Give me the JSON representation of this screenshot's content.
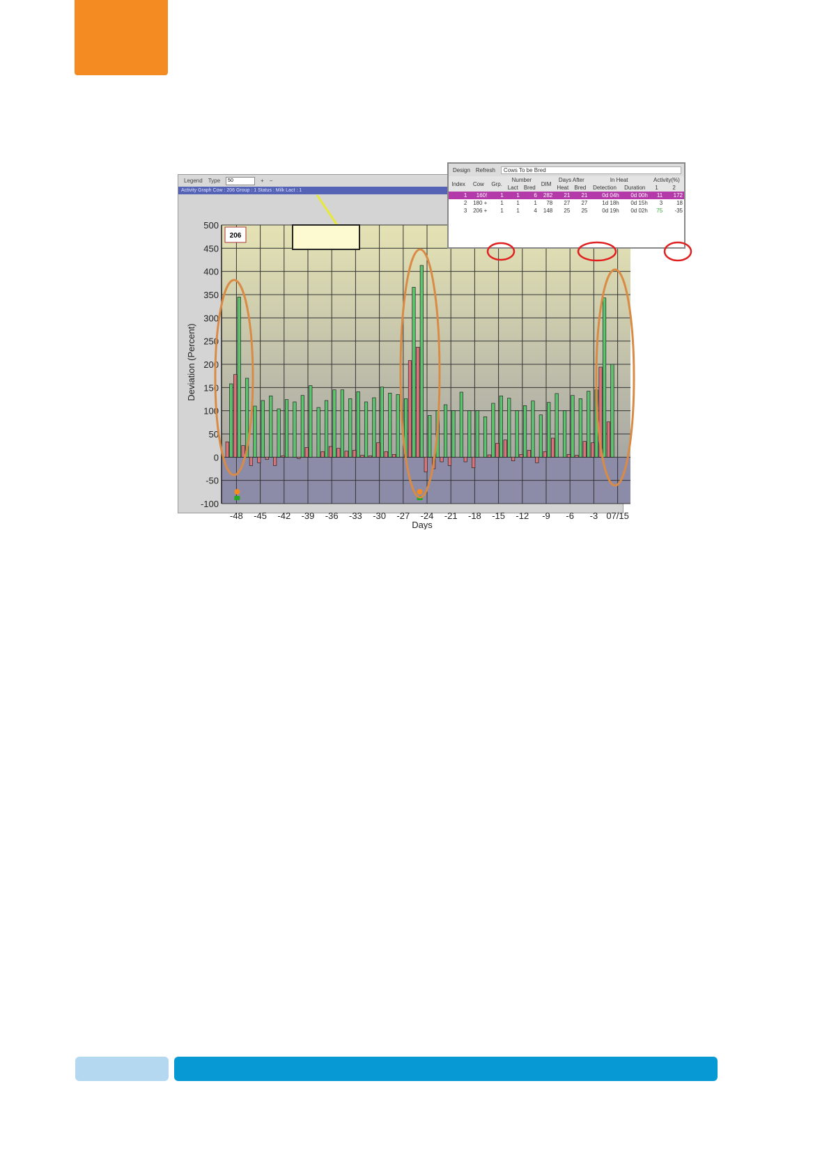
{
  "toolbar": {
    "legend": "Legend",
    "type": "Type",
    "zoom_value": "50"
  },
  "status_bar": "Activity Graph   Cow : 206   Group : 1   Status : Milk   Lact : 1",
  "cow_label": "206",
  "table_panel": {
    "design": "Design",
    "refresh": "Refresh",
    "report": "Cows To be Bred",
    "groups": [
      "Number",
      "Days After",
      "In Heat",
      "Activity(%)"
    ],
    "columns": [
      "Index",
      "Cow",
      "Grp.",
      "Lact",
      "Bred",
      "DIM",
      "Heat",
      "Bred",
      "Detection",
      "Duration",
      "1",
      "2"
    ],
    "rows": [
      [
        "1",
        "160!",
        "1",
        "1",
        "6",
        "282",
        "21",
        "21",
        "0d 04h",
        "0d 00h",
        "11",
        "172"
      ],
      [
        "2",
        "180 +",
        "1",
        "1",
        "1",
        "78",
        "27",
        "27",
        "1d 18h",
        "0d 15h",
        "3",
        "18"
      ],
      [
        "3",
        "206 +",
        "1",
        "1",
        "4",
        "148",
        "25",
        "25",
        "0d 19h",
        "0d 02h",
        "75",
        "-35"
      ]
    ]
  },
  "colors": {
    "green": "#5cc46e",
    "red": "#d9757a",
    "selected_row": "#b33aa8",
    "highlight_oval": "#d98b45",
    "circle": "#e02020",
    "accent_orange": "#f48a22",
    "accent_blue": "#0699d4"
  },
  "chart_data": {
    "type": "bar",
    "xlabel": "Days",
    "ylabel": "Deviation  (Percent)",
    "ylim": [
      -100,
      500
    ],
    "yticks": [
      500,
      450,
      400,
      350,
      300,
      250,
      200,
      150,
      100,
      50,
      0,
      -50,
      -100
    ],
    "xtick_labels": [
      "-48",
      "-45",
      "-42",
      "-39",
      "-36",
      "-33",
      "-30",
      "-27",
      "-24",
      "-21",
      "-18",
      "-15",
      "-12",
      "-9",
      "-6",
      "-3",
      "07/15"
    ],
    "x": [
      -49,
      -48,
      -47,
      -46,
      -45,
      -44,
      -43,
      -42,
      -41,
      -40,
      -39,
      -38,
      -37,
      -36,
      -35,
      -34,
      -33,
      -32,
      -31,
      -30,
      -29,
      -28,
      -27,
      -26,
      -25,
      -24,
      -23,
      -22,
      -21,
      -20,
      -19,
      -18,
      -17,
      -16,
      -15,
      -14,
      -13,
      -12,
      -11,
      -10,
      -9,
      -8,
      -7,
      -6,
      -5,
      -4,
      -3,
      -2,
      -1,
      0
    ],
    "series": [
      {
        "color": "#d9757a",
        "values": [
          33,
          178,
          25,
          -18,
          -12,
          -5,
          -18,
          3,
          0,
          -3,
          21,
          0,
          12,
          23,
          19,
          13,
          15,
          4,
          3,
          31,
          12,
          6,
          0,
          208,
          237,
          -32,
          -25,
          -10,
          -18,
          0,
          -10,
          -23,
          0,
          5,
          30,
          37,
          -8,
          6,
          15,
          -12,
          12,
          41,
          0,
          6,
          4,
          34,
          31,
          194,
          76,
          0
        ]
      },
      {
        "color": "#5cc46e",
        "values": [
          158,
          345,
          170,
          110,
          122,
          132,
          104,
          124,
          119,
          133,
          154,
          107,
          122,
          145,
          145,
          126,
          141,
          119,
          128,
          151,
          138,
          135,
          126,
          366,
          413,
          90,
          100,
          113,
          100,
          140,
          100,
          100,
          87,
          116,
          132,
          127,
          100,
          111,
          121,
          91,
          118,
          137,
          100,
          133,
          126,
          142,
          145,
          343,
          200,
          0
        ]
      }
    ]
  }
}
